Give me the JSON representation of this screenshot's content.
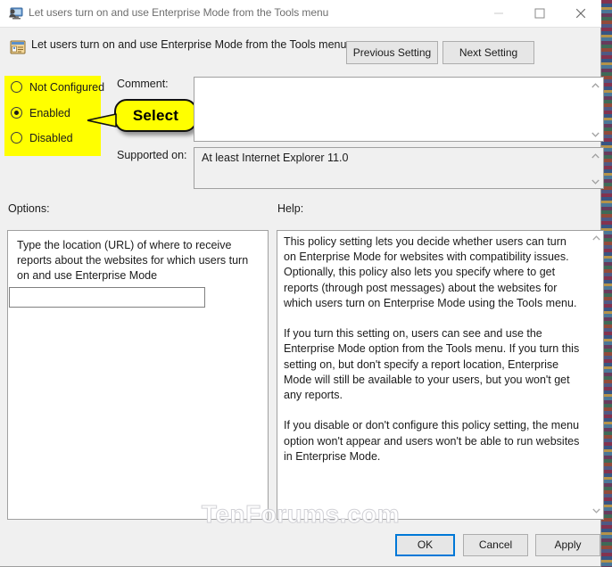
{
  "window": {
    "title": "Let users turn on and use Enterprise Mode from the Tools menu",
    "icon": "policy-user-monitor-icon",
    "controls": {
      "minimize": "minimize-icon",
      "maximize": "maximize-icon",
      "close": "close-icon"
    }
  },
  "header": {
    "icon": "policy-setting-icon",
    "title": "Let users turn on and use Enterprise Mode from the Tools menu",
    "previous_button": "Previous Setting",
    "next_button": "Next Setting"
  },
  "state_options": {
    "not_configured": {
      "label": "Not Configured",
      "selected": false
    },
    "enabled": {
      "label": "Enabled",
      "selected": true
    },
    "disabled": {
      "label": "Disabled",
      "selected": false
    },
    "highlight_color": "#ffff00"
  },
  "callout": {
    "text": "Select",
    "fill": "#ffff00",
    "border": "#111111"
  },
  "comment": {
    "label": "Comment:",
    "value": "",
    "placeholder": ""
  },
  "supported_on": {
    "label": "Supported on:",
    "value": "At least Internet Explorer 11.0"
  },
  "options": {
    "label": "Options:",
    "description": "Type the location (URL) of where to receive reports about the websites for which users turn on and use Enterprise Mode",
    "url_field_value": "",
    "url_field_placeholder": ""
  },
  "help": {
    "label": "Help:",
    "text": "This policy setting lets you decide whether users can turn on Enterprise Mode for websites with compatibility issues. Optionally, this policy also lets you specify where to get reports (through post messages) about the websites for which users turn on Enterprise Mode using the Tools menu.\n\nIf you turn this setting on, users can see and use the Enterprise Mode option from the Tools menu. If you turn this setting on, but don't specify a report location, Enterprise Mode will still be available to your users, but you won't get any reports.\n\nIf you disable or don't configure this policy setting, the menu option won't appear and users won't be able to run websites in Enterprise Mode."
  },
  "watermark": {
    "text": "TenForums.com"
  },
  "footer": {
    "ok": "OK",
    "cancel": "Cancel",
    "apply": "Apply",
    "focus_color": "#0078d7"
  }
}
